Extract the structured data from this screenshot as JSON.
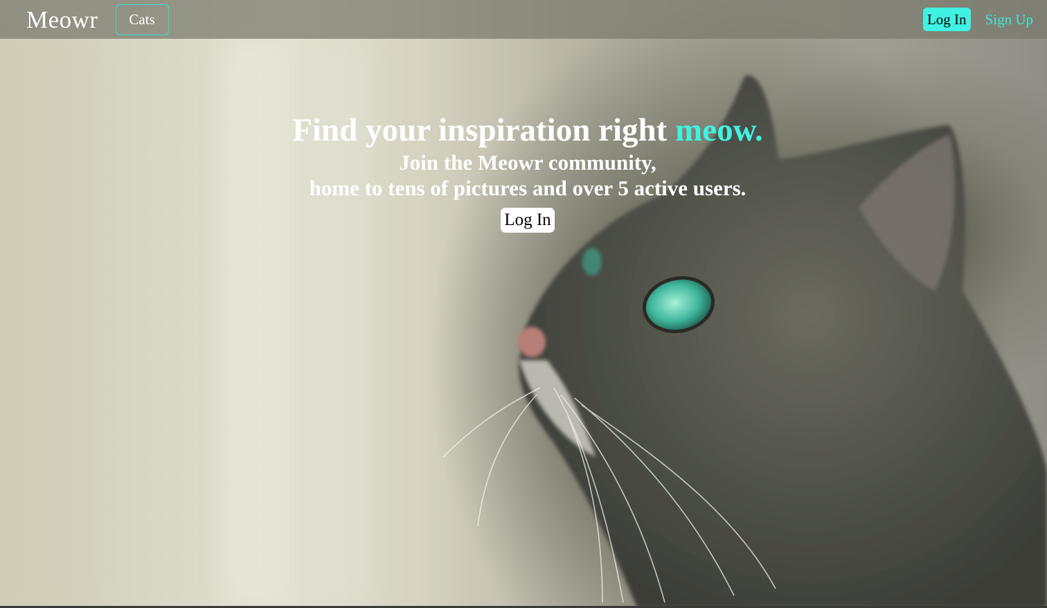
{
  "navbar": {
    "brand": "Meowr",
    "cats_label": "Cats",
    "login_label": "Log In",
    "signup_label": "Sign Up"
  },
  "hero": {
    "headline": "Find your inspiration right",
    "headline_accent": "meow.",
    "subline_1": "Join the Meowr community,",
    "subline_2": "home to tens of pictures and over 5 active users.",
    "login_label": "Log In",
    "background_image": "cat-photo"
  },
  "colors": {
    "accent": "#3ff2e2",
    "text": "#ffffff",
    "button_bg": "#ffffff"
  }
}
